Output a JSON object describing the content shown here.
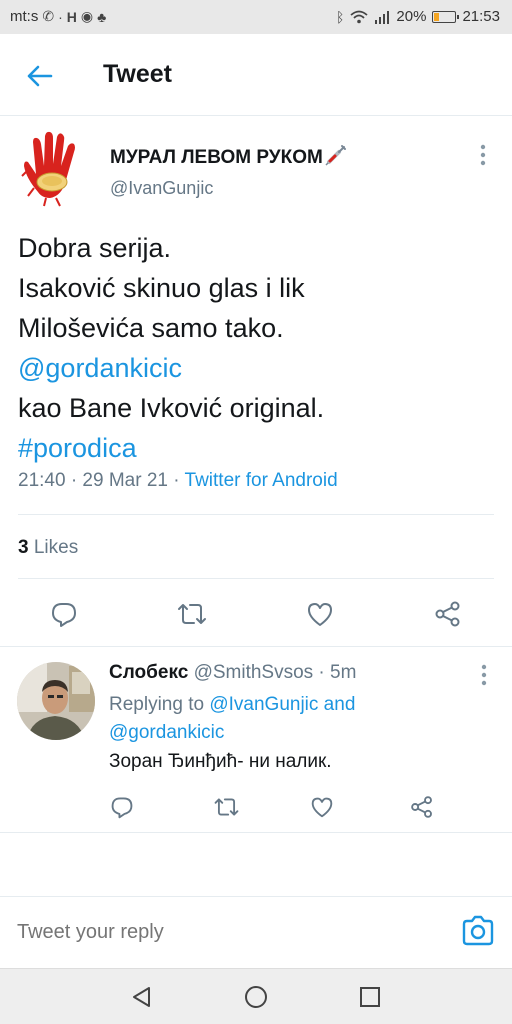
{
  "status_bar": {
    "carrier": "mt:s",
    "battery_percent_text": "20%",
    "battery_level": 0.2,
    "time": "21:53",
    "icons": [
      "phone-wifi-icon",
      "hd-icon",
      "chrome-icon",
      "notification-icon",
      "bluetooth-icon",
      "wifi-icon",
      "signal-icon",
      "battery-icon"
    ]
  },
  "header": {
    "title": "Tweet",
    "back_icon": "arrow-left-icon"
  },
  "main_tweet": {
    "author_name": "МУРАЛ ЛЕВОМ РУКОМ",
    "author_emoji": "syringe-icon",
    "handle": "@IvanGunjic",
    "lines": [
      "Dobra serija.",
      "Isaković skinuo glas i lik",
      "Miloševića samo tako."
    ],
    "mention": "@gordankicic",
    "line_after_mention": "kao Bane Ivković original.",
    "hashtag": "#porodica",
    "timestamp": "21:40 · 29 Mar 21 · ",
    "source": "Twitter for Android",
    "likes_count": "3",
    "likes_label": "Likes"
  },
  "reply": {
    "name": "Слобекс",
    "handle_time": "@SmithSvsos · 5m",
    "replying_prefix": "Replying to ",
    "replying_to_1": "@IvanGunjic",
    "replying_and": " and",
    "replying_to_2": "@gordankicic",
    "text": "Зоран Ђинђић- ни налик."
  },
  "compose": {
    "placeholder": "Tweet your reply"
  },
  "colors": {
    "accent": "#1b95e0",
    "text": "#14171a",
    "secondary": "#657786",
    "divider": "#e6ecf0"
  }
}
